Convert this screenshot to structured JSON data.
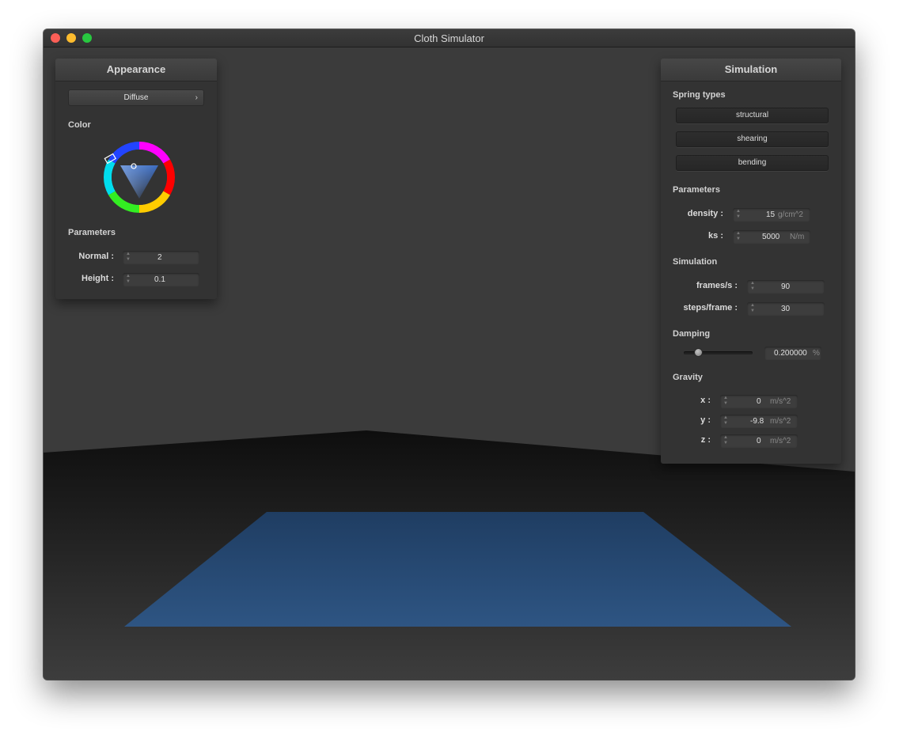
{
  "window": {
    "title": "Cloth Simulator"
  },
  "appearance": {
    "header": "Appearance",
    "shader_value": "Diffuse",
    "color_label": "Color",
    "parameters_label": "Parameters",
    "normal_label": "Normal :",
    "normal_value": "2",
    "height_label": "Height :",
    "height_value": "0.1"
  },
  "simulation": {
    "header": "Simulation",
    "spring_types_label": "Spring types",
    "spring_buttons": [
      "structural",
      "shearing",
      "bending"
    ],
    "parameters_label": "Parameters",
    "density_label": "density :",
    "density_value": "15",
    "density_unit": "g/cm^2",
    "ks_label": "ks :",
    "ks_value": "5000",
    "ks_unit": "N/m",
    "simulation_label": "Simulation",
    "fps_label": "frames/s :",
    "fps_value": "90",
    "steps_label": "steps/frame :",
    "steps_value": "30",
    "damping_label": "Damping",
    "damping_value": "0.200000",
    "damping_unit": "%",
    "damping_slider_fraction": 0.2,
    "gravity_label": "Gravity",
    "gx_label": "x :",
    "gx_value": "0",
    "gx_unit": "m/s^2",
    "gy_label": "y :",
    "gy_value": "-9.8",
    "gy_unit": "m/s^2",
    "gz_label": "z :",
    "gz_value": "0",
    "gz_unit": "m/s^2"
  },
  "colors": {
    "cloth": "#2d5280",
    "background": "#3b3b3b",
    "floor_dark": "#111111"
  }
}
